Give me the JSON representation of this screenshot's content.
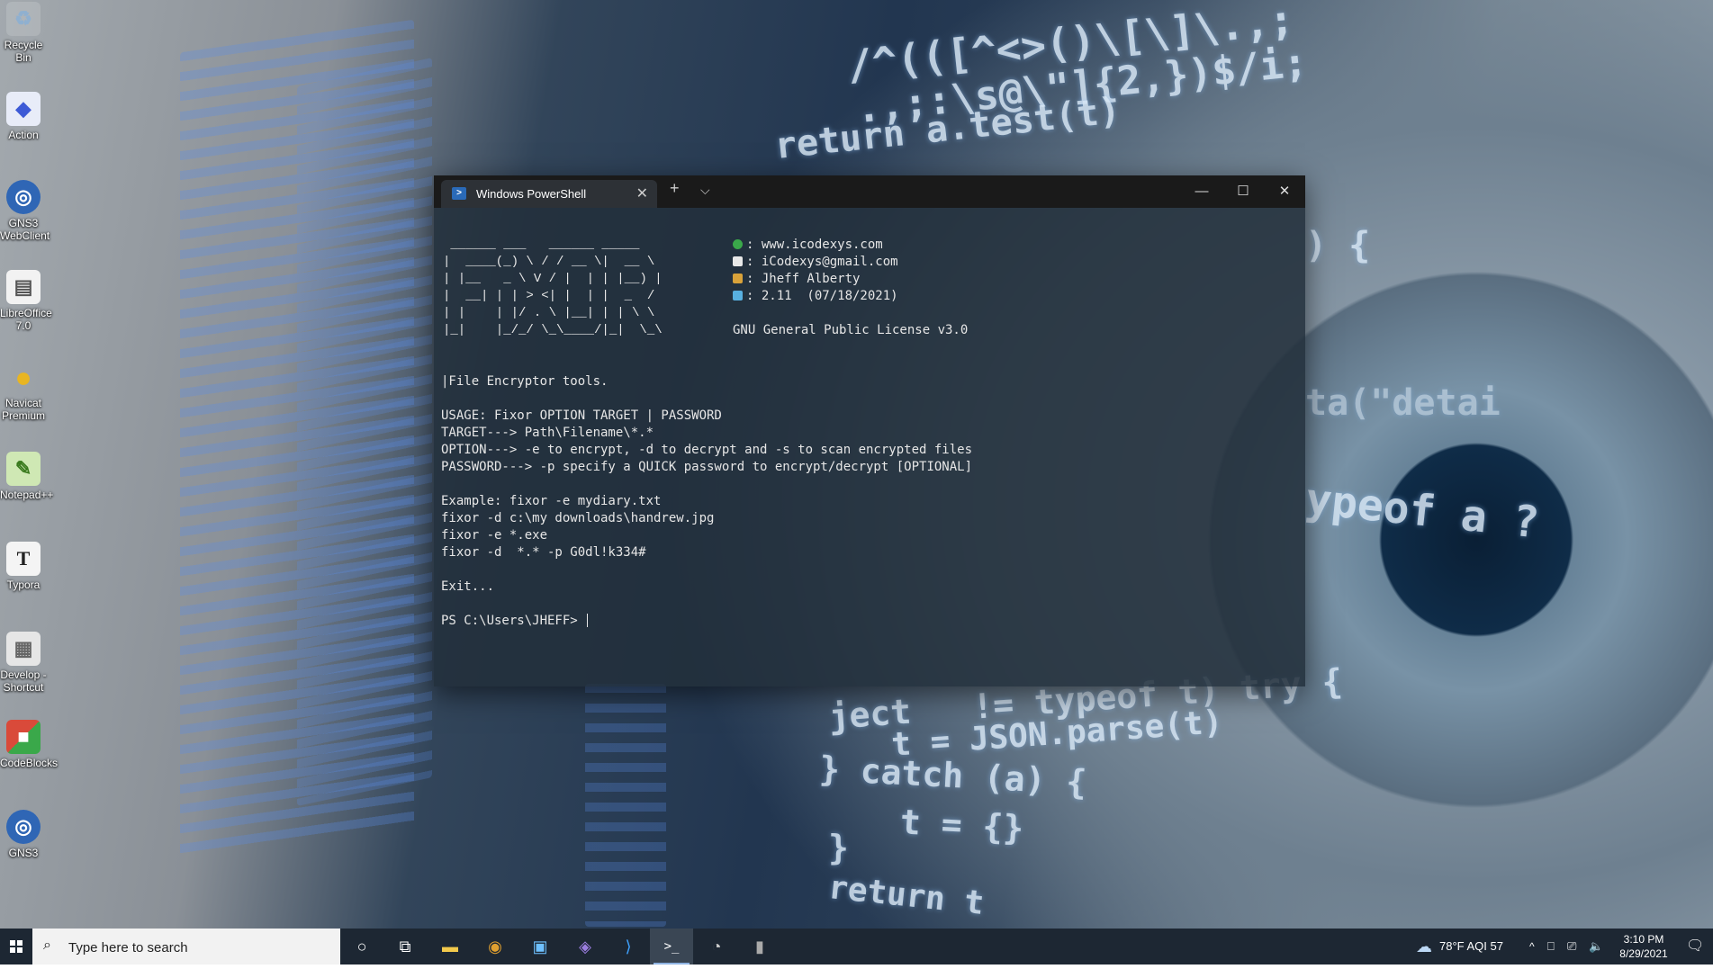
{
  "desktop": {
    "background_code": [
      "/^(([^<>()\\[\\]\\.,;",
      ".,;:\\s@\\\"]{2,})$/i;",
      "return a.test(t)",
      ") {",
      "ta(\"detai",
      "ypeof a ?",
      "ject   != typeof t) try {",
      "t = JSON.parse(t)",
      "} catch (a) {",
      "t = {}",
      "}",
      "return t"
    ],
    "icons": [
      {
        "label": "Recycle Bin",
        "glyph": "♻",
        "color": "#8fb0d0"
      },
      {
        "label": "Action",
        "glyph": "◆",
        "color": "#3d5ad6"
      },
      {
        "label": "GNS3 WebClient",
        "glyph": "◎",
        "color": "#2f66b5"
      },
      {
        "label": "LibreOffice 7.0",
        "glyph": "▤",
        "color": "#e8e8e8"
      },
      {
        "label": "Navicat Premium",
        "glyph": "●",
        "color": "#e8b522"
      },
      {
        "label": "Notepad++",
        "glyph": "✎",
        "color": "#7bbf4a"
      },
      {
        "label": "Typora",
        "glyph": "T",
        "color": "#f4f4f4"
      },
      {
        "label": "Develop - Shortcut",
        "glyph": "▦",
        "color": "#e0e0e0"
      },
      {
        "label": "CodeBlocks",
        "glyph": "■",
        "color": "#d94a3a"
      },
      {
        "label": "GNS3",
        "glyph": "◎",
        "color": "#2f66b5"
      }
    ]
  },
  "terminal": {
    "tab_title": "Windows PowerShell",
    "new_tab_glyph": "+",
    "dropdown_glyph": "⌵",
    "close_tab_glyph": "✕",
    "minimize_glyph": "—",
    "maximize_glyph": "☐",
    "close_glyph": "✕",
    "ascii_art": " ______ ___   ______ _____\n|  ____(_) \\ / / __ \\|  __ \\\n| |__   _ \\ V / |  | | |__) |\n|  __| | | > <| |  | |  _  /\n| |    | |/ . \\ |__| | | \\ \\\n|_|    |_/_/ \\_\\____/|_|  \\_\\",
    "info": [
      {
        "icon": "globe-icon",
        "color": "#3aa84a",
        "text": ": www.icodexys.com"
      },
      {
        "icon": "mail-icon",
        "color": "#e8e8e8",
        "text": ": iCodexys@gmail.com"
      },
      {
        "icon": "hammer-icon",
        "color": "#d9a23a",
        "text": ": Jheff Alberty"
      },
      {
        "icon": "chart-icon",
        "color": "#58b0e0",
        "text": ": 2.11  (07/18/2021)"
      }
    ],
    "license": "GNU General Public License v3.0",
    "lines": [
      "|File Encryptor tools.",
      "",
      "USAGE: Fixor OPTION TARGET | PASSWORD",
      "TARGET---> Path\\Filename\\*.*",
      "OPTION---> -e to encrypt, -d to decrypt and -s to scan encrypted files",
      "PASSWORD---> -p specify a QUICK password to encrypt/decrypt [OPTIONAL]",
      "",
      "Example: fixor -e mydiary.txt",
      "fixor -d c:\\my downloads\\handrew.jpg",
      "fixor -e *.exe",
      "fixor -d  *.* -p G0dl!k334#",
      "",
      "Exit...",
      ""
    ],
    "prompt": "PS C:\\Users\\JHEFF> "
  },
  "taskbar": {
    "start_glyph": "⊞",
    "search_placeholder": "Type here to search",
    "apps": [
      {
        "name": "cortana",
        "glyph": "○"
      },
      {
        "name": "task-view",
        "glyph": "⧉"
      },
      {
        "name": "file-explorer",
        "glyph": "▬"
      },
      {
        "name": "chrome",
        "glyph": "◉"
      },
      {
        "name": "app-n",
        "glyph": "▣"
      },
      {
        "name": "visual-studio",
        "glyph": "◈"
      },
      {
        "name": "vscode",
        "glyph": "⟩"
      },
      {
        "name": "terminal",
        "glyph": ">_"
      },
      {
        "name": "obs",
        "glyph": "◔"
      },
      {
        "name": "app-misc",
        "glyph": "▮"
      }
    ],
    "weather": "78°F  AQI 57",
    "time": "3:10 PM",
    "date": "8/29/2021"
  },
  "colors": {
    "terminal_bg": "#222e3a",
    "titlebar": "#1a1a1a",
    "taskbar": "#1d2733",
    "accent": "#8fb4e3"
  }
}
